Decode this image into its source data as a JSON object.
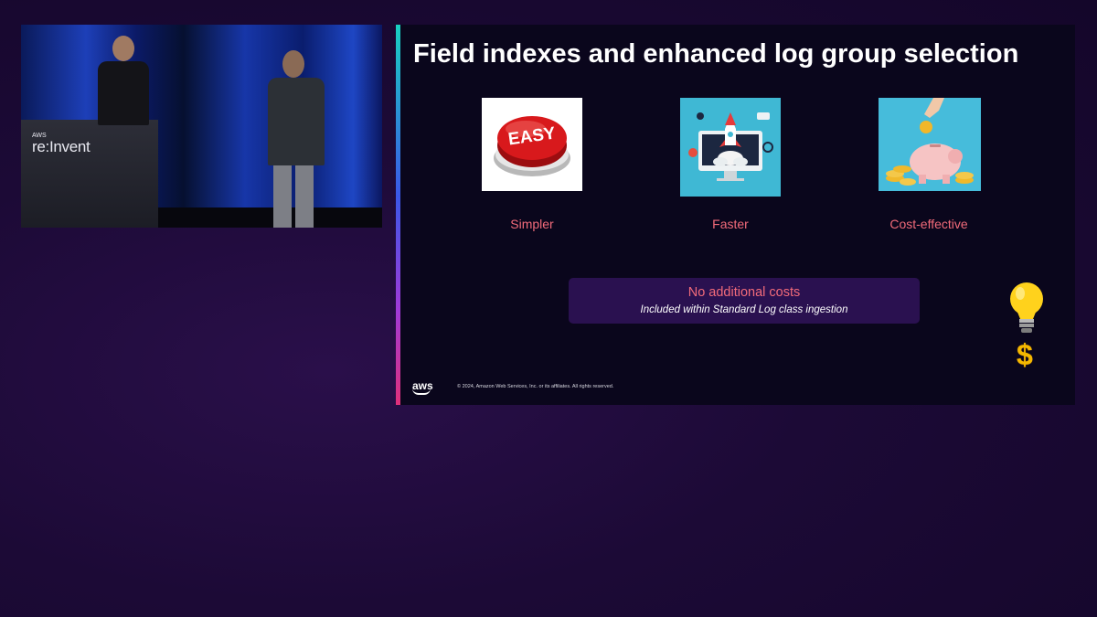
{
  "video": {
    "brand_small": "AWS",
    "brand_large": "re:Invent"
  },
  "slide": {
    "title": "Field indexes and enhanced log group selection",
    "features": [
      {
        "label": "Simpler",
        "icon": "easy-button-icon",
        "icon_text": "EASY"
      },
      {
        "label": "Faster",
        "icon": "rocket-launch-icon"
      },
      {
        "label": "Cost-effective",
        "icon": "piggy-bank-icon"
      }
    ],
    "callout": {
      "title": "No additional costs",
      "subtitle": "Included within Standard Log class ingestion"
    },
    "side_icons": [
      "lightbulb-icon",
      "dollar-sign-icon"
    ],
    "dollar_symbol": "$",
    "footer": {
      "logo_text": "aws",
      "copyright": "© 2024, Amazon Web Services, Inc. or its affiliates. All rights reserved."
    },
    "colors": {
      "accent_text": "#f26b7a",
      "callout_bg": "#2a1150",
      "slide_bg": "#0a061c"
    }
  }
}
